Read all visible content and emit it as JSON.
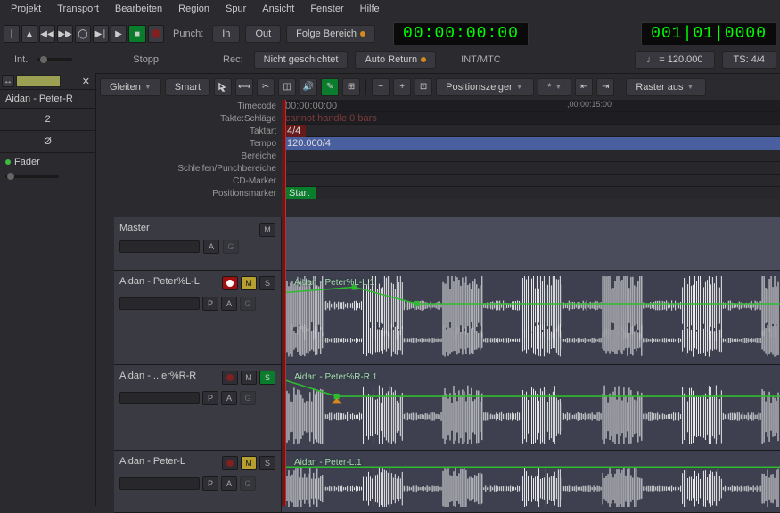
{
  "menu": {
    "items": [
      "Projekt",
      "Transport",
      "Bearbeiten",
      "Region",
      "Spur",
      "Ansicht",
      "Fenster",
      "Hilfe"
    ]
  },
  "transport": {
    "punch_label": "Punch:",
    "in_label": "In",
    "out_label": "Out",
    "follow_label": "Folge Bereich",
    "timecode_main": "00:00:00:00",
    "timecode_bbt": "001|01|0000",
    "int_label": "Int.",
    "state_label": "Stopp",
    "rec_label": "Rec:",
    "rec_mode": "Nicht geschichtet",
    "auto_return": "Auto Return",
    "sync_src": "INT/MTC",
    "tempo": "♩ = 120.000",
    "time_sig_label": "TS: 4/4"
  },
  "toolbar": {
    "mode1": "Gleiten",
    "mode2": "Smart",
    "snap_mode": "Positionszeiger",
    "filter": "*",
    "grid": "Raster aus"
  },
  "sidebar": {
    "strip_name": "Aidan - Peter-R",
    "value": "2",
    "null_symbol": "Ø",
    "fader_label": "Fader"
  },
  "rulers": {
    "timecode": "Timecode",
    "beats": "Takte:Schläge",
    "meter": "Taktart",
    "tempo": "Tempo",
    "ranges": "Bereiche",
    "loops": "Schleifen/Punchbereiche",
    "cd": "CD-Marker",
    "markers": "Positionsmarker",
    "tc_start": "00:00:00:00",
    "tc_mid": ",00:00:15:00",
    "bars_error": "cannot handle 0 bars",
    "meter_val": "4/4",
    "tempo_val": "120.000/4",
    "start_marker": "Start"
  },
  "master": {
    "name": "Master",
    "btn_m": "M",
    "btn_a": "A",
    "btn_g": "G"
  },
  "tracks": [
    {
      "name": "Aidan - Peter%L-L",
      "region_name": "Aidan - Peter%L-L.1",
      "rec": true,
      "mute": true,
      "solo": false,
      "btns2": [
        "P",
        "A",
        "G"
      ]
    },
    {
      "name": "Aidan - ...er%R-R",
      "region_name": "Aidan - Peter%R-R.1",
      "rec": false,
      "mute": false,
      "solo": true,
      "btns2": [
        "P",
        "A",
        "G"
      ]
    },
    {
      "name": "Aidan - Peter-L",
      "region_name": "Aidan - Peter-L.1",
      "rec": false,
      "mute": true,
      "solo": false,
      "btns2": [
        "P",
        "A",
        "G"
      ]
    }
  ],
  "btn_labels": {
    "m": "M",
    "s": "S",
    "p": "P",
    "a": "A",
    "g": "G"
  }
}
